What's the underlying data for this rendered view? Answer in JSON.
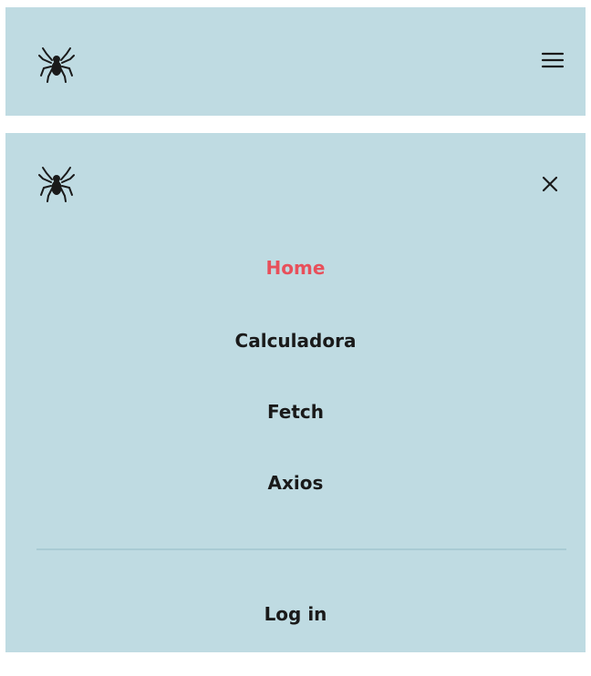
{
  "header": {
    "logo_icon": "spider-logo-icon",
    "menu_icon": "hamburger-menu-icon"
  },
  "menu": {
    "logo_icon": "spider-logo-icon",
    "close_icon": "close-icon",
    "items": [
      {
        "label": "Home",
        "active": true
      },
      {
        "label": "Calculadora",
        "active": false
      },
      {
        "label": "Fetch",
        "active": false
      },
      {
        "label": "Axios",
        "active": false
      }
    ],
    "login_label": "Log in"
  },
  "colors": {
    "background": "#bfdbe2",
    "active": "#e8505b",
    "text": "#1a1a1a",
    "divider": "#a9cbd4"
  }
}
